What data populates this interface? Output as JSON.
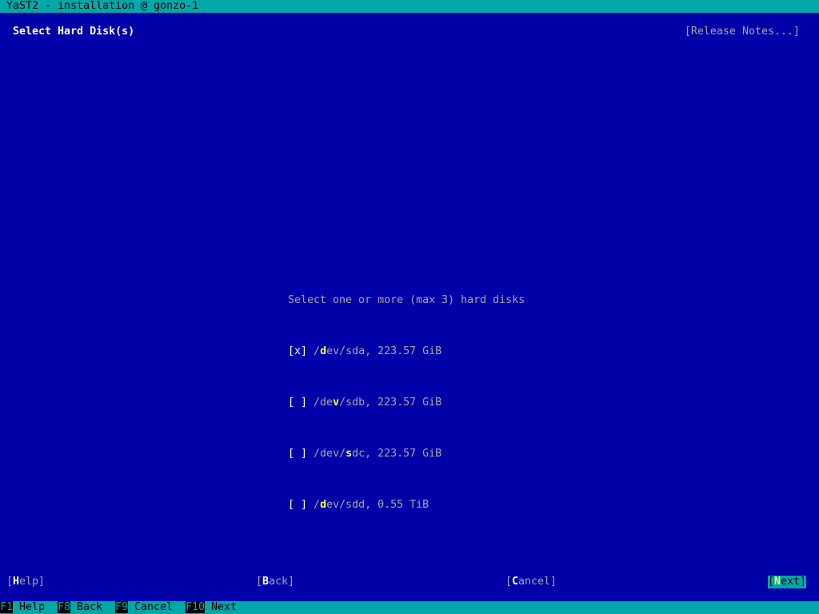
{
  "window": {
    "title": "YaST2 - installation @ gonzo-1"
  },
  "header": {
    "title": "Select Hard Disk(s)",
    "release_notes": "[Release Notes...]"
  },
  "disk_selector": {
    "label": "Select one or more (max 3) hard disks",
    "items": [
      {
        "box": "[x]",
        "pre": "/",
        "hot": "d",
        "post": "ev/sda, 223.57 GiB"
      },
      {
        "box": "[ ]",
        "pre": "/de",
        "hot": "v",
        "post": "/sdb, 223.57 GiB"
      },
      {
        "box": "[ ]",
        "pre": "/dev/",
        "hot": "s",
        "post": "dc, 223.57 GiB"
      },
      {
        "box": "[ ]",
        "pre": "/",
        "hot": "d",
        "post": "ev/sdd, 0.55 TiB"
      }
    ]
  },
  "buttons": {
    "help": {
      "open": "[",
      "hot": "H",
      "rest": "elp]"
    },
    "back": {
      "open": "[",
      "hot": "B",
      "rest": "ack]"
    },
    "cancel": {
      "open": "[",
      "hot": "C",
      "rest": "ancel]"
    },
    "next": {
      "open": "[",
      "hot": "N",
      "rest": "ext]"
    }
  },
  "function_keys": [
    {
      "key": "F1",
      "label": "Help"
    },
    {
      "key": "F8",
      "label": "Back"
    },
    {
      "key": "F9",
      "label": "Cancel"
    },
    {
      "key": "F10",
      "label": "Next"
    }
  ],
  "colors": {
    "background": "#0000a8",
    "bar": "#00a8a8",
    "hotkey": "#ffff54",
    "text": "#a8a8a8"
  }
}
